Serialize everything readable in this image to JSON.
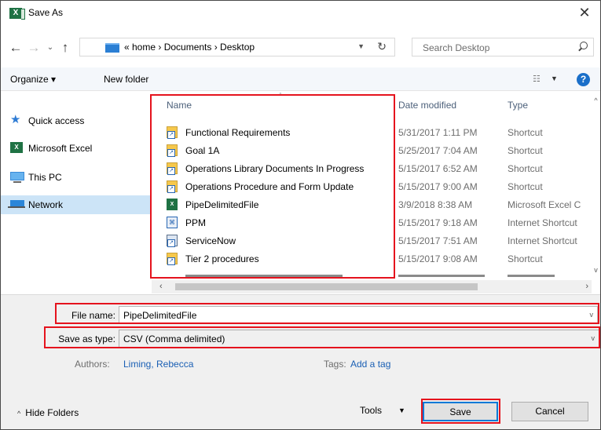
{
  "window": {
    "title": "Save As",
    "app_icon": "excel-icon",
    "close_glyph": "✕"
  },
  "address": {
    "breadcrumb": "« home  ›  Documents  ›  Desktop",
    "search_placeholder": "Search Desktop"
  },
  "toolbar": {
    "organize_label": "Organize ▾",
    "new_folder_label": "New folder",
    "help_glyph": "?"
  },
  "nav_pane": {
    "items": [
      {
        "label": "Quick access",
        "icon": "star-icon"
      },
      {
        "label": "Microsoft Excel",
        "icon": "excel-icon"
      },
      {
        "label": "This PC",
        "icon": "computer-icon"
      },
      {
        "label": "Network",
        "icon": "network-icon",
        "selected": true
      }
    ]
  },
  "file_list": {
    "columns": {
      "name": "Name",
      "date": "Date modified",
      "type": "Type"
    },
    "rows": [
      {
        "name": "Functional Requirements",
        "date": "5/31/2017 1:11 PM",
        "type": "Shortcut",
        "icon": "shortcut-icon"
      },
      {
        "name": "Goal 1A",
        "date": "5/25/2017 7:04 AM",
        "type": "Shortcut",
        "icon": "shortcut-icon"
      },
      {
        "name": "Operations Library Documents In Progress",
        "date": "5/15/2017 6:52 AM",
        "type": "Shortcut",
        "icon": "shortcut-icon"
      },
      {
        "name": "Operations Procedure and Form Update",
        "date": "5/15/2017 9:00 AM",
        "type": "Shortcut",
        "icon": "shortcut-icon"
      },
      {
        "name": "PipeDelimitedFile",
        "date": "3/9/2018 8:38 AM",
        "type": "Microsoft Excel C",
        "icon": "excel-file-icon"
      },
      {
        "name": "PPM",
        "date": "5/15/2017 9:18 AM",
        "type": "Internet Shortcut",
        "icon": "internet-shortcut-icon"
      },
      {
        "name": "ServiceNow",
        "date": "5/15/2017 7:51 AM",
        "type": "Internet Shortcut",
        "icon": "internet-shortcut-icon"
      },
      {
        "name": "Tier 2 procedures",
        "date": "5/15/2017 9:08 AM",
        "type": "Shortcut",
        "icon": "shortcut-icon"
      }
    ]
  },
  "form": {
    "file_name_label": "File name:",
    "file_name_value": "PipeDelimitedFile",
    "save_type_label": "Save as type:",
    "save_type_value": "CSV (Comma delimited)",
    "authors_label": "Authors:",
    "authors_value": "Liming, Rebecca",
    "tags_label": "Tags:",
    "tags_value": "Add a tag"
  },
  "footer": {
    "hide_folders_label": "Hide Folders",
    "tools_label": "Tools",
    "save_label": "Save",
    "cancel_label": "Cancel"
  },
  "colors": {
    "annotation_red": "#e5131d",
    "selection_blue": "#cce4f7",
    "link_blue": "#1a5fb4",
    "primary_border": "#0078d7"
  }
}
